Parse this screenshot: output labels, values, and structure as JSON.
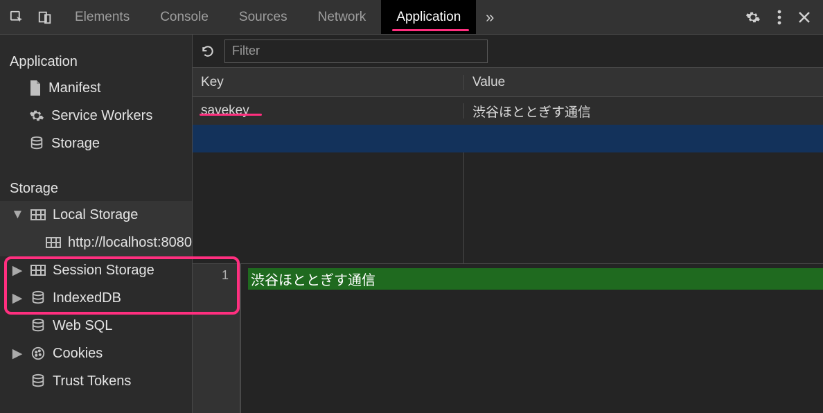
{
  "topbar": {
    "tabs": [
      "Elements",
      "Console",
      "Sources",
      "Network",
      "Application"
    ],
    "active_tab": "Application"
  },
  "sidebar": {
    "application": {
      "title": "Application",
      "items": [
        {
          "icon": "file",
          "label": "Manifest"
        },
        {
          "icon": "gear",
          "label": "Service Workers"
        },
        {
          "icon": "db",
          "label": "Storage"
        }
      ]
    },
    "storage": {
      "title": "Storage",
      "items": [
        {
          "expander": "open",
          "icon": "grid",
          "label": "Local Storage",
          "children": [
            {
              "icon": "grid",
              "label": "http://localhost:8080",
              "selected": true
            }
          ]
        },
        {
          "expander": "closed",
          "icon": "grid",
          "label": "Session Storage"
        },
        {
          "expander": "closed",
          "icon": "db",
          "label": "IndexedDB"
        },
        {
          "icon": "db",
          "label": "Web SQL"
        },
        {
          "expander": "closed",
          "icon": "cookie",
          "label": "Cookies"
        },
        {
          "icon": "db",
          "label": "Trust Tokens"
        }
      ]
    }
  },
  "toolbar": {
    "filter_placeholder": "Filter"
  },
  "table": {
    "headers": {
      "key": "Key",
      "value": "Value"
    },
    "rows": [
      {
        "key": "savekey",
        "value": "渋谷ほととぎす通信",
        "selected_below": true
      }
    ]
  },
  "preview": {
    "line_number": "1",
    "text": "渋谷ほととぎす通信"
  }
}
